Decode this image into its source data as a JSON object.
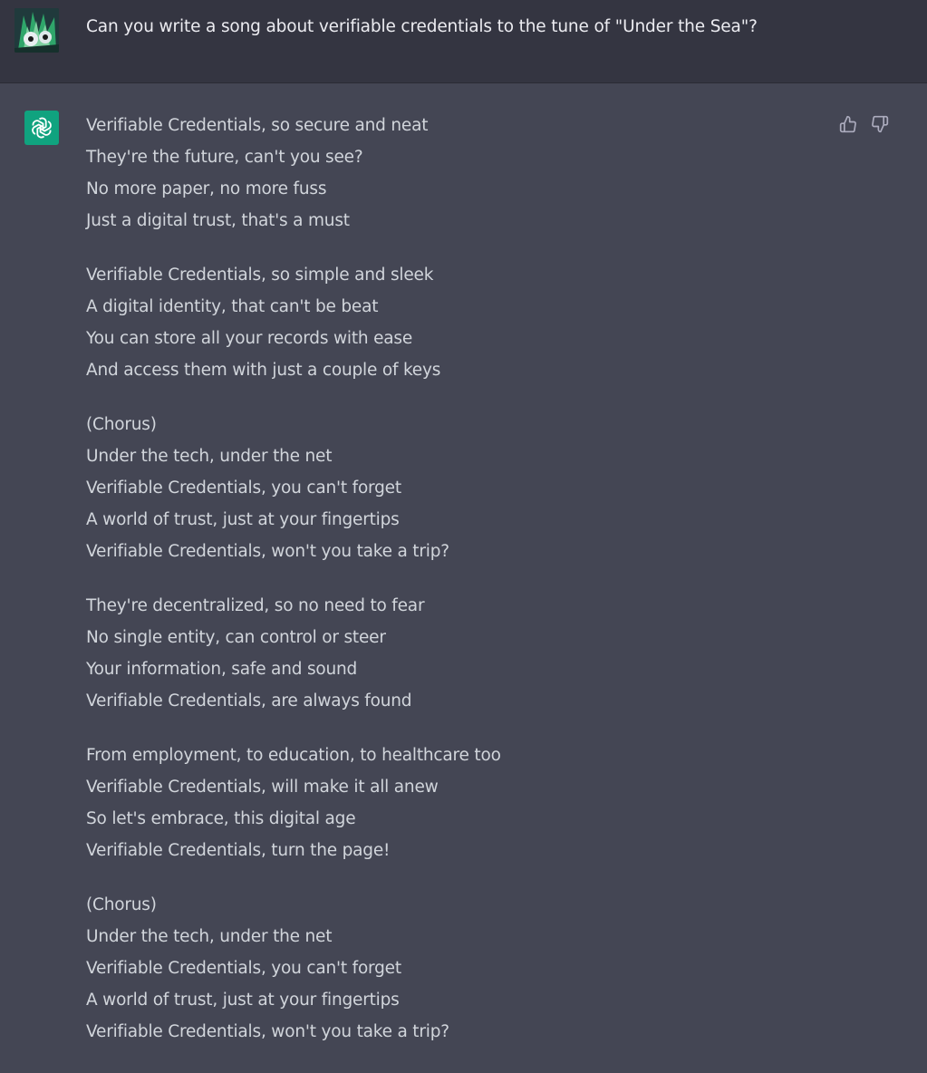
{
  "user": {
    "avatar_icon": "user-avatar-icon",
    "prompt": "Can you write a song about verifiable credentials to the tune of \"Under the Sea\"?"
  },
  "assistant": {
    "avatar_icon": "openai-logo-icon",
    "feedback": {
      "up_icon": "thumbs-up-icon",
      "down_icon": "thumbs-down-icon"
    },
    "stanzas": [
      [
        "Verifiable Credentials, so secure and neat",
        "They're the future, can't you see?",
        "No more paper, no more fuss",
        "Just a digital trust, that's a must"
      ],
      [
        "Verifiable Credentials, so simple and sleek",
        "A digital identity, that can't be beat",
        "You can store all your records with ease",
        "And access them with just a couple of keys"
      ],
      [
        "(Chorus)",
        "Under the tech, under the net",
        "Verifiable Credentials, you can't forget",
        "A world of trust, just at your fingertips",
        "Verifiable Credentials, won't you take a trip?"
      ],
      [
        "They're decentralized, so no need to fear",
        "No single entity, can control or steer",
        "Your information, safe and sound",
        "Verifiable Credentials, are always found"
      ],
      [
        "From employment, to education, to healthcare too",
        "Verifiable Credentials, will make it all anew",
        "So let's embrace, this digital age",
        "Verifiable Credentials, turn the page!"
      ],
      [
        "(Chorus)",
        "Under the tech, under the net",
        "Verifiable Credentials, you can't forget",
        "A world of trust, just at your fingertips",
        "Verifiable Credentials, won't you take a trip?"
      ]
    ]
  },
  "colors": {
    "user_bg": "#343541",
    "assistant_bg": "#444654",
    "assistant_avatar_bg": "#10a37f",
    "text": "#d1d5db",
    "prompt_text": "#ececf1"
  }
}
